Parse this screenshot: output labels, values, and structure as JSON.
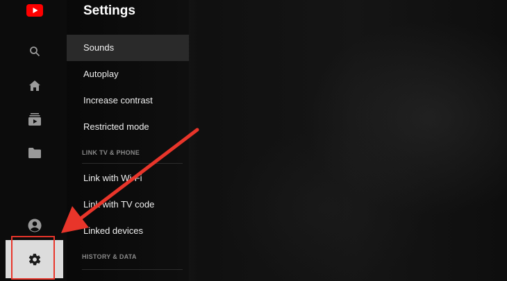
{
  "page_title": "Settings",
  "menu": {
    "items": [
      {
        "label": "Sounds",
        "selected": true
      },
      {
        "label": "Autoplay",
        "selected": false
      },
      {
        "label": "Increase contrast",
        "selected": false
      },
      {
        "label": "Restricted mode",
        "selected": false
      }
    ],
    "section_link": "LINK TV & PHONE",
    "link_items": [
      {
        "label": "Link with Wi-Fi"
      },
      {
        "label": "Link with TV code"
      },
      {
        "label": "Linked devices"
      }
    ],
    "section_history": "HISTORY & DATA"
  },
  "rail": {
    "icons": [
      "youtube-logo",
      "search-icon",
      "home-icon",
      "subscriptions-icon",
      "library-icon",
      "account-icon",
      "gear-icon"
    ],
    "selected": "gear-icon"
  },
  "colors": {
    "accent_red": "#e8352a",
    "youtube_red": "#ff0000",
    "selected_item_bg": "#2a2a2a",
    "selected_rail_bg": "#dcdcdc"
  }
}
